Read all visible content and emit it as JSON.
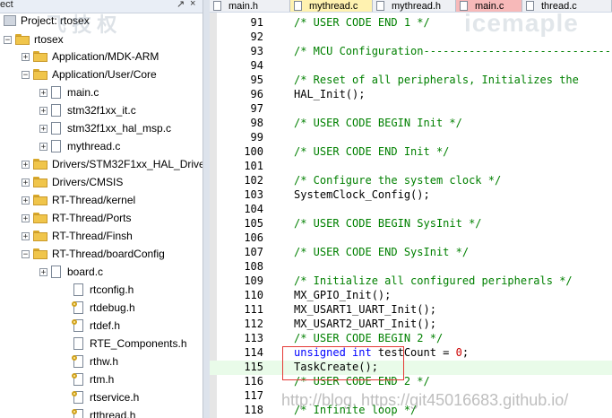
{
  "project": {
    "header_left": "ect",
    "pin_glyph": "↗",
    "close_glyph": "×",
    "project_label": "Project: rtosex",
    "target": "rtosex",
    "groups": [
      {
        "label": "Application/MDK-ARM",
        "expanded": false
      },
      {
        "label": "Application/User/Core",
        "expanded": true,
        "files": [
          "main.c",
          "stm32f1xx_it.c",
          "stm32f1xx_hal_msp.c",
          "mythread.c"
        ]
      },
      {
        "label": "Drivers/STM32F1xx_HAL_Driver",
        "expanded": false
      },
      {
        "label": "Drivers/CMSIS",
        "expanded": false
      },
      {
        "label": "RT-Thread/kernel",
        "expanded": false
      },
      {
        "label": "RT-Thread/Ports",
        "expanded": false
      },
      {
        "label": "RT-Thread/Finsh",
        "expanded": false
      },
      {
        "label": "RT-Thread/boardConfig",
        "expanded": true,
        "files": [
          "board.c"
        ],
        "headers": [
          "rtconfig.h",
          "rtdebug.h",
          "rtdef.h",
          "RTE_Components.h",
          "rthw.h",
          "rtm.h",
          "rtservice.h",
          "rtthread.h"
        ]
      }
    ]
  },
  "tabs": [
    {
      "label": "main.h",
      "style": "normal"
    },
    {
      "label": "mythread.c",
      "style": "active"
    },
    {
      "label": "mythread.h",
      "style": "normal"
    },
    {
      "label": "main.c",
      "style": "red"
    },
    {
      "label": "thread.c",
      "style": "normal"
    }
  ],
  "editor": {
    "highlight_line": "115",
    "lines": [
      {
        "n": "91",
        "parts": [
          {
            "t": "/* USER CODE END 1 */",
            "k": "comment"
          }
        ]
      },
      {
        "n": "92",
        "parts": []
      },
      {
        "n": "93",
        "parts": [
          {
            "t": "/* MCU Configuration----------------------------------",
            "k": "comment"
          }
        ]
      },
      {
        "n": "94",
        "parts": []
      },
      {
        "n": "95",
        "parts": [
          {
            "t": "/* Reset of all peripherals, Initializes the",
            "k": "comment"
          }
        ]
      },
      {
        "n": "96",
        "parts": [
          {
            "t": "HAL_Init();",
            "k": "plain"
          }
        ]
      },
      {
        "n": "97",
        "parts": []
      },
      {
        "n": "98",
        "parts": [
          {
            "t": "/* USER CODE BEGIN Init */",
            "k": "comment"
          }
        ]
      },
      {
        "n": "99",
        "parts": []
      },
      {
        "n": "100",
        "parts": [
          {
            "t": "/* USER CODE END Init */",
            "k": "comment"
          }
        ]
      },
      {
        "n": "101",
        "parts": []
      },
      {
        "n": "102",
        "parts": [
          {
            "t": "/* Configure the system clock */",
            "k": "comment"
          }
        ]
      },
      {
        "n": "103",
        "parts": [
          {
            "t": "SystemClock_Config();",
            "k": "plain"
          }
        ]
      },
      {
        "n": "104",
        "parts": []
      },
      {
        "n": "105",
        "parts": [
          {
            "t": "/* USER CODE BEGIN SysInit */",
            "k": "comment"
          }
        ]
      },
      {
        "n": "106",
        "parts": []
      },
      {
        "n": "107",
        "parts": [
          {
            "t": "/* USER CODE END SysInit */",
            "k": "comment"
          }
        ]
      },
      {
        "n": "108",
        "parts": []
      },
      {
        "n": "109",
        "parts": [
          {
            "t": "/* Initialize all configured peripherals */",
            "k": "comment"
          }
        ]
      },
      {
        "n": "110",
        "parts": [
          {
            "t": "MX_GPIO_Init();",
            "k": "plain"
          }
        ]
      },
      {
        "n": "111",
        "parts": [
          {
            "t": "MX_USART1_UART_Init();",
            "k": "plain"
          }
        ]
      },
      {
        "n": "112",
        "parts": [
          {
            "t": "MX_USART2_UART_Init();",
            "k": "plain"
          }
        ]
      },
      {
        "n": "113",
        "parts": [
          {
            "t": "/* USER CODE BEGIN 2 */",
            "k": "comment"
          }
        ]
      },
      {
        "n": "114",
        "parts": [
          {
            "t": "unsigned int ",
            "k": "kw"
          },
          {
            "t": "testCount = ",
            "k": "plain"
          },
          {
            "t": "0",
            "k": "num"
          },
          {
            "t": ";",
            "k": "plain"
          }
        ]
      },
      {
        "n": "115",
        "parts": [
          {
            "t": "TaskCreate();",
            "k": "plain"
          }
        ]
      },
      {
        "n": "116",
        "parts": [
          {
            "t": "/* USER CODE END 2 */",
            "k": "comment"
          }
        ]
      },
      {
        "n": "117",
        "parts": []
      },
      {
        "n": "118",
        "parts": [
          {
            "t": "/* Infinite loop */",
            "k": "comment"
          }
        ]
      }
    ]
  },
  "watermarks": {
    "top_right": "icemaple",
    "top_left": "飞 技 权",
    "bottom": "http://blog. https://git45016683.github.io/"
  }
}
